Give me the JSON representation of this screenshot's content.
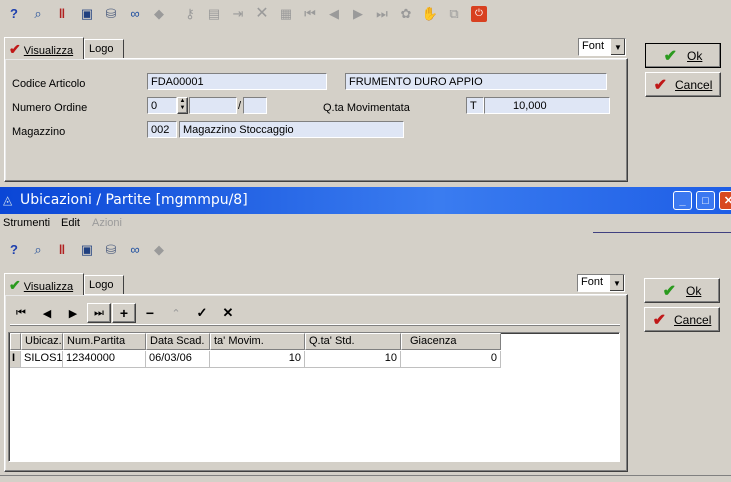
{
  "top_toolbar": {
    "icons": [
      "help-icon",
      "search-doc-icon",
      "ruler-icon",
      "monitor-icon",
      "database-icon",
      "glasses-icon",
      "diamond-icon",
      "key-icon",
      "edit-record-icon",
      "export-icon",
      "delete-icon",
      "grid-icon",
      "first-record-icon",
      "prev-record-icon",
      "next-record-icon",
      "last-record-icon",
      "refresh-icon",
      "hand-icon",
      "copy-icon",
      "close-app-icon"
    ]
  },
  "upper_form": {
    "tabs": [
      "Visualizza",
      "Logo"
    ],
    "font_combo": "Font",
    "ok_label": "Ok",
    "cancel_label": "Cancel",
    "codice_articolo_label": "Codice Articolo",
    "codice_articolo_value": "FDA00001",
    "descrizione_value": "FRUMENTO DURO APPIO",
    "numero_ordine_label": "Numero Ordine",
    "numero_ordine_value": "0",
    "slash": "/",
    "qta_label": "Q.ta Movimentata",
    "qta_unit": "T",
    "qta_value": "10,000",
    "magazzino_label": "Magazzino",
    "magazzino_code": "002",
    "magazzino_desc": "Magazzino Stoccaggio"
  },
  "lower_window": {
    "title": "Ubicazioni / Partite [mgmmpu/8]",
    "menu": [
      "Strumenti",
      "Edit",
      "Azioni"
    ],
    "tabs": [
      "Visualizza",
      "Logo"
    ],
    "font_combo": "Font",
    "ok_label": "Ok",
    "cancel_label": "Cancel",
    "grid": {
      "columns": [
        "Ubicaz.",
        "Num.Partita",
        "Data Scad.",
        "ta' Movim.",
        "Q.ta' Std.",
        "Giacenza"
      ],
      "row": [
        "SILOS1",
        "12340000",
        "06/03/06",
        "10",
        "10",
        "0"
      ],
      "row_indicator": "I"
    }
  },
  "colors": {
    "field_bg": "#dfe6f5",
    "title_bar": "#0a46d6",
    "ok_check": "#2a9a1e",
    "cancel_cross": "#c01818"
  }
}
